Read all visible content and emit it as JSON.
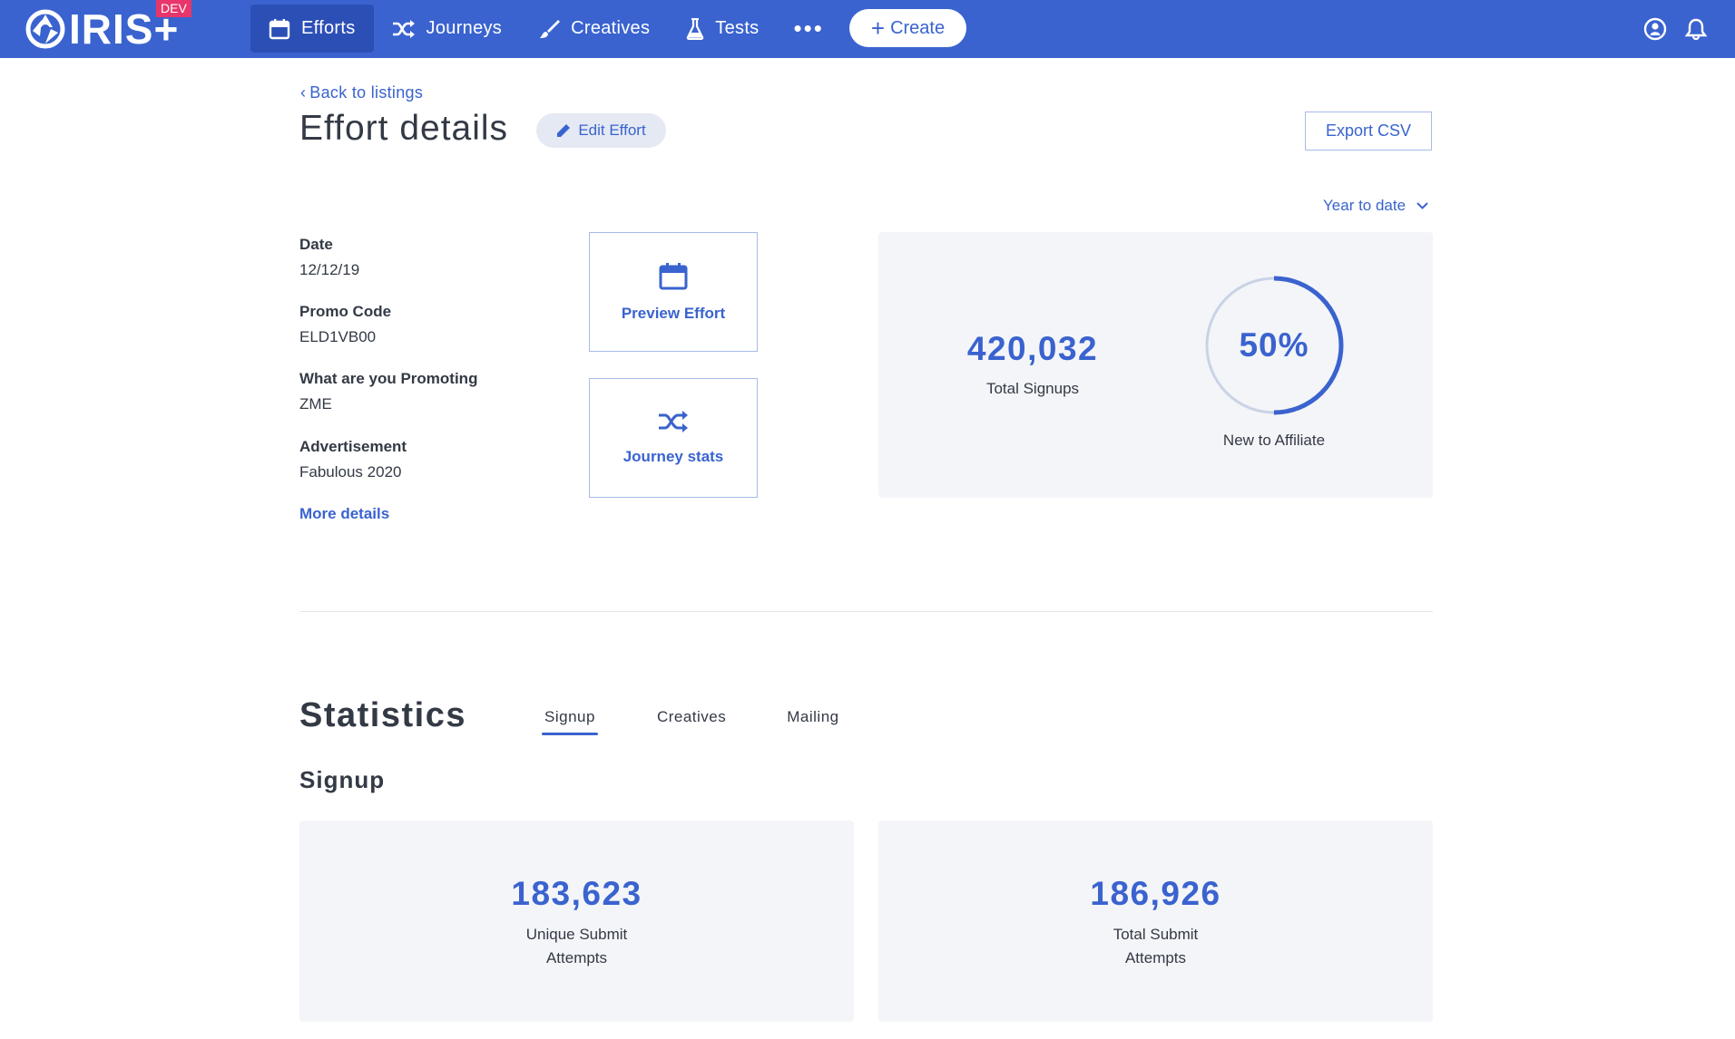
{
  "app": {
    "logo_text": "IRIS+",
    "env_badge": "DEV"
  },
  "nav": {
    "items": [
      {
        "label": "Efforts",
        "icon": "calendar-icon",
        "active": true
      },
      {
        "label": "Journeys",
        "icon": "shuffle-icon",
        "active": false
      },
      {
        "label": "Creatives",
        "icon": "brush-icon",
        "active": false
      },
      {
        "label": "Tests",
        "icon": "flask-icon",
        "active": false
      }
    ],
    "more_label": "•••",
    "create_label": "Create"
  },
  "header": {
    "back_label": "Back to listings",
    "title": "Effort details",
    "edit_label": "Edit Effort",
    "export_label": "Export CSV",
    "range_label": "Year to date"
  },
  "details": [
    {
      "label": "Date",
      "value": "12/12/19"
    },
    {
      "label": "Promo Code",
      "value": "ELD1VB00"
    },
    {
      "label": "What are you Promoting",
      "value": "ZME"
    },
    {
      "label": "Advertisement",
      "value": "Fabulous 2020"
    }
  ],
  "more_details_label": "More details",
  "actions": {
    "preview_label": "Preview Effort",
    "journey_label": "Journey stats"
  },
  "summary": {
    "total_signups": "420,032",
    "total_signups_label": "Total Signups",
    "new_to_affiliate_percent": "50%",
    "new_to_affiliate_fraction": 0.5,
    "new_to_affiliate_label": "New to Affiliate"
  },
  "statistics": {
    "title": "Statistics",
    "tabs": [
      {
        "label": "Signup",
        "active": true
      },
      {
        "label": "Creatives",
        "active": false
      },
      {
        "label": "Mailing",
        "active": false
      }
    ],
    "section_title": "Signup",
    "metrics": [
      {
        "value": "183,623",
        "label_line1": "Unique Submit",
        "label_line2": "Attempts"
      },
      {
        "value": "186,926",
        "label_line1": "Total Submit",
        "label_line2": "Attempts"
      }
    ]
  },
  "colors": {
    "brand": "#3a63cf",
    "brand_dark": "#2c4fb6",
    "badge": "#e8366a",
    "card_bg": "#f4f5f8",
    "ring_track": "#c9d3e6"
  }
}
